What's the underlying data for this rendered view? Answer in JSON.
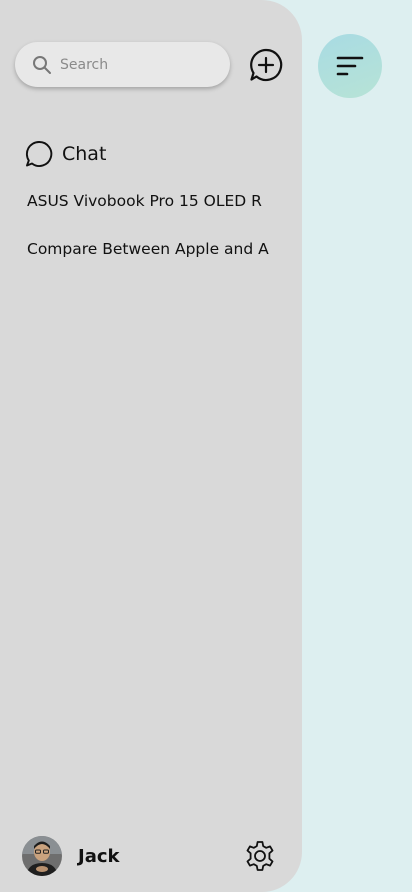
{
  "search": {
    "placeholder": "Search"
  },
  "chat": {
    "title": "Chat"
  },
  "history": [
    {
      "label": "ASUS Vivobook Pro 15 OLED R"
    },
    {
      "label": "Compare Between Apple and A"
    }
  ],
  "user": {
    "name": "Jack"
  },
  "icons": {
    "search": "search-icon",
    "new_chat": "plus-circle-chat-icon",
    "chat": "chat-bubble-icon",
    "settings": "gear-icon",
    "menu": "filter-menu-icon"
  },
  "colors": {
    "drawer": "#d9d9d9",
    "background": "#ddeff0",
    "accent_start": "#a8dbe3",
    "accent_end": "#b7e3d6"
  }
}
